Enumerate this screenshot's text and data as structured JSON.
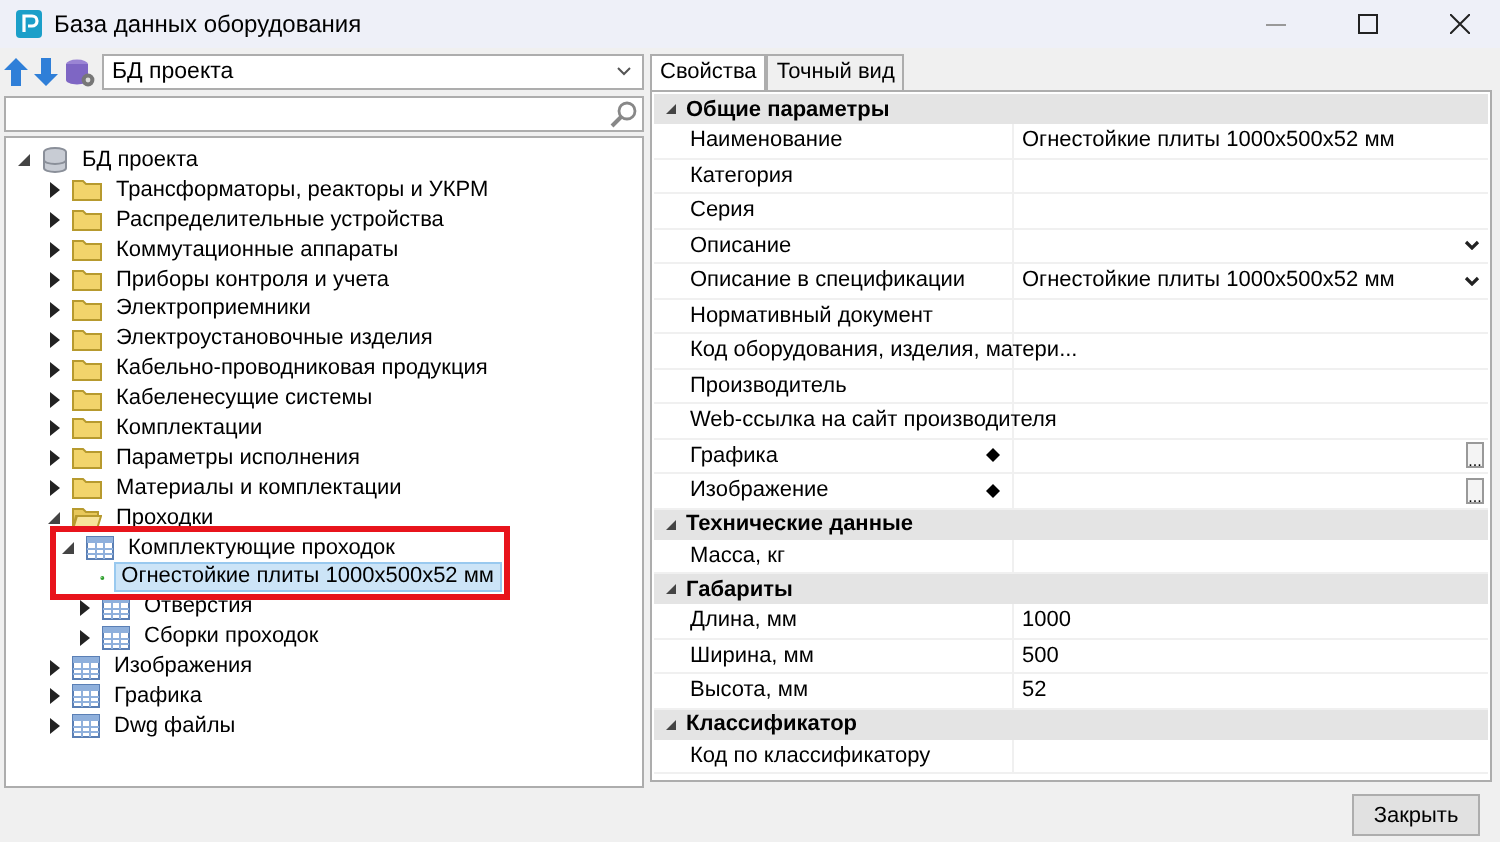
{
  "window": {
    "title": "База данных оборудования"
  },
  "source": {
    "value": "БД проекта"
  },
  "tree": [
    {
      "label": "БД проекта",
      "kind": "database",
      "expanded": true,
      "selected": false,
      "children": [
        {
          "label": "Трансформаторы, реакторы и УКРМ",
          "kind": "folder",
          "expanded": false,
          "selected": false
        },
        {
          "label": "Распределительные устройства",
          "kind": "folder",
          "expanded": false,
          "selected": false
        },
        {
          "label": "Коммутационные аппараты",
          "kind": "folder",
          "expanded": false,
          "selected": false
        },
        {
          "label": "Приборы контроля и учета",
          "kind": "folder",
          "expanded": false,
          "selected": false
        },
        {
          "label": "Электроприемники",
          "kind": "folder",
          "expanded": false,
          "selected": false
        },
        {
          "label": "Электроустановочные изделия",
          "kind": "folder",
          "expanded": false,
          "selected": false
        },
        {
          "label": "Кабельно-проводниковая продукция",
          "kind": "folder",
          "expanded": false,
          "selected": false
        },
        {
          "label": "Кабеленесущие системы",
          "kind": "folder",
          "expanded": false,
          "selected": false
        },
        {
          "label": "Комплектации",
          "kind": "folder",
          "expanded": false,
          "selected": false
        },
        {
          "label": "Параметры исполнения",
          "kind": "folder",
          "expanded": false,
          "selected": false
        },
        {
          "label": "Материалы и комплектации",
          "kind": "folder",
          "expanded": false,
          "selected": false
        },
        {
          "label": "Проходки",
          "kind": "folder",
          "expanded": true,
          "selected": false,
          "children": [
            {
              "label": "Комплектующие проходок",
              "kind": "table",
              "expanded": true,
              "selected": false,
              "annotated": true,
              "children": [
                {
                  "label": "Огнестойкие плиты 1000x500x52 мм",
                  "kind": "item",
                  "selected": true
                }
              ]
            },
            {
              "label": "Отверстия",
              "kind": "table",
              "expanded": false,
              "selected": false
            },
            {
              "label": "Сборки проходок",
              "kind": "table",
              "expanded": false,
              "selected": false
            }
          ]
        },
        {
          "label": "Изображения",
          "kind": "table",
          "expanded": false,
          "selected": false
        },
        {
          "label": "Графика",
          "kind": "table",
          "expanded": false,
          "selected": false
        },
        {
          "label": "Dwg файлы",
          "kind": "table",
          "expanded": false,
          "selected": false
        }
      ]
    }
  ],
  "tabs": [
    {
      "label": "Свойства",
      "selected": true
    },
    {
      "label": "Точный вид",
      "selected": false
    }
  ],
  "properties": [
    {
      "category": "Общие параметры",
      "expanded": true,
      "rows": [
        {
          "name": "Наименование",
          "value": "Огнестойкие плиты 1000x500x52 мм"
        },
        {
          "name": "Категория"
        },
        {
          "name": "Серия"
        },
        {
          "name": "Описание",
          "dropdown": true
        },
        {
          "name": "Описание в спецификации",
          "value": "Огнестойкие плиты 1000x500x52 мм",
          "dropdown": true
        },
        {
          "name": "Нормативный документ"
        },
        {
          "name": "Код оборудования, изделия, матери..."
        },
        {
          "name": "Производитель"
        },
        {
          "name": "Web-ссылка на сайт производителя"
        },
        {
          "name": "Графика",
          "marker": true,
          "browse": "..."
        },
        {
          "name": "Изображение",
          "marker": true,
          "browse": "..."
        }
      ]
    },
    {
      "category": "Технические данные",
      "expanded": true,
      "rows": [
        {
          "name": "Масса, кг"
        }
      ]
    },
    {
      "category": "Габариты",
      "expanded": true,
      "rows": [
        {
          "name": "Длина, мм",
          "value": "1000"
        },
        {
          "name": "Ширина, мм",
          "value": "500"
        },
        {
          "name": "Высота, мм",
          "value": "52"
        }
      ]
    },
    {
      "category": "Классификатор",
      "expanded": true,
      "rows": [
        {
          "name": "Код по классификатору"
        }
      ]
    }
  ],
  "buttons": [
    "Закрыть"
  ]
}
